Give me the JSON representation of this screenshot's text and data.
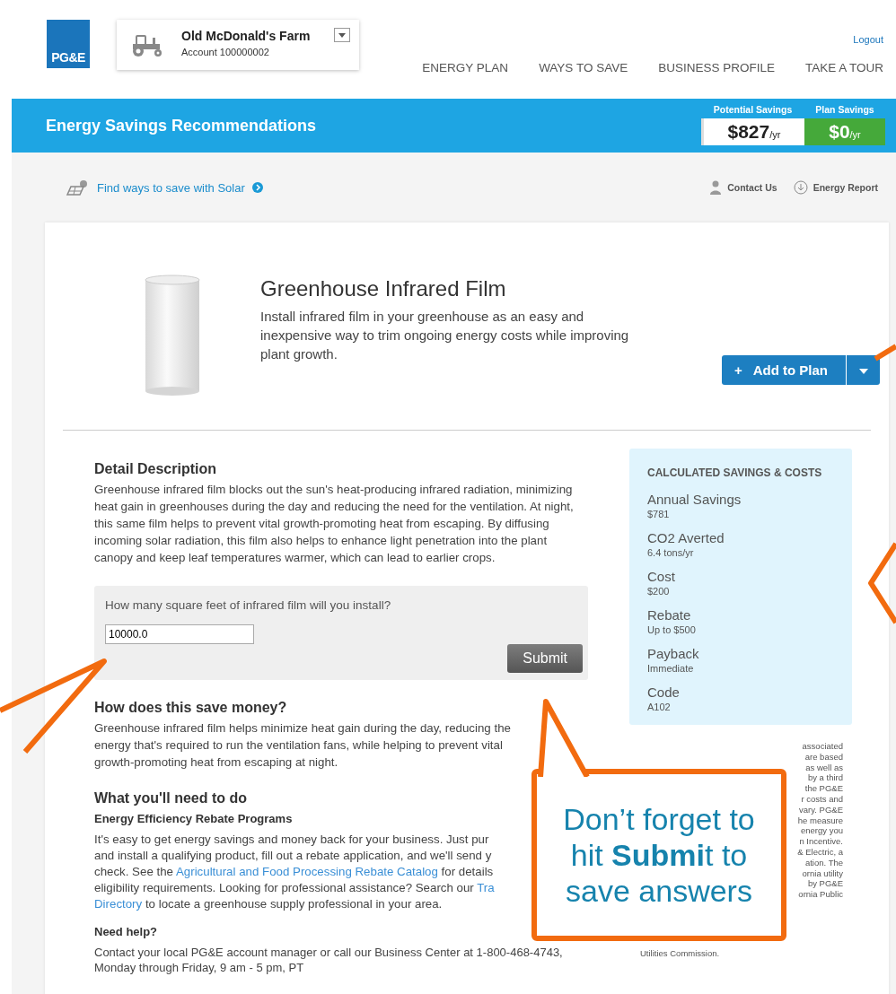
{
  "header": {
    "logo": "PG&E",
    "account": {
      "name": "Old McDonald's Farm",
      "number": "Account 100000002"
    },
    "logout": "Logout",
    "nav": [
      {
        "label": "ENERGY PLAN"
      },
      {
        "label": "WAYS TO SAVE"
      },
      {
        "label": "BUSINESS PROFILE"
      },
      {
        "label": "TAKE A TOUR"
      }
    ]
  },
  "banner": {
    "title": "Energy Savings Recommendations",
    "savings": [
      {
        "kind": "potential",
        "label": "Potential Savings",
        "amount": "$827",
        "unit": "/yr"
      },
      {
        "kind": "plan",
        "label": "Plan Savings",
        "amount": "$0",
        "unit": "/yr"
      }
    ]
  },
  "toolbar": {
    "solar_link": "Find ways to save with Solar",
    "links": [
      {
        "kind": "contact",
        "label": "Contact Us"
      },
      {
        "kind": "report",
        "label": "Energy Report"
      }
    ]
  },
  "product": {
    "title": "Greenhouse Infrared Film",
    "description": "Install infrared film in your greenhouse as an easy and inexpensive way to trim ongoing energy costs while improving plant growth.",
    "add_icon": "+",
    "add_button": "Add to Plan"
  },
  "detail": {
    "heading": "Detail Description",
    "text": "Greenhouse infrared film blocks out the sun's heat-producing infrared radiation, minimizing heat gain in greenhouses during the day and reducing the need for the ventilation. At night, this same film helps to prevent vital growth-promoting heat from escaping. By diffusing incoming solar radiation, this film also helps to enhance light penetration into the plant canopy and keep leaf temperatures warmer, which can lead to earlier crops."
  },
  "question": {
    "label": "How many square feet of infrared film will you install?",
    "value": "10000.0",
    "submit": "Submit"
  },
  "how": {
    "heading": "How does this save money?",
    "text": "Greenhouse infrared film helps minimize heat gain during the day, reducing the energy that's required to run the ventilation fans, while helping to prevent vital growth-promoting heat from escaping at night."
  },
  "todo": {
    "heading": "What you'll need to do",
    "subheading": "Energy Efficiency Rebate Programs",
    "lines": [
      [
        {
          "text": "It's easy to get energy savings and money back for your business. Just pur",
          "link": false
        }
      ],
      [
        {
          "text": "and install a qualifying product, fill out a rebate application, and we'll send y",
          "link": false
        }
      ],
      [
        {
          "text": "check. See the ",
          "link": false
        },
        {
          "text": "Agricultural and Food Processing Rebate Catalog",
          "link": true
        },
        {
          "text": " for details",
          "link": false
        }
      ],
      [
        {
          "text": "eligibility requirements. Looking for professional assistance? Search our ",
          "link": false
        },
        {
          "text": "Tra",
          "link": true
        }
      ],
      [
        {
          "text": "Directory",
          "link": true
        },
        {
          "text": " to locate a greenhouse supply professional in your area.",
          "link": false
        }
      ]
    ]
  },
  "help": {
    "heading": "Need help?",
    "text": "Contact your local PG&E account manager or call our Business Center at 1-800-468-4743, Monday through Friday, 9 am - 5 pm, PT"
  },
  "panel": {
    "title": "CALCULATED SAVINGS & COSTS",
    "items": [
      {
        "label": "Annual Savings",
        "value": "$781"
      },
      {
        "label": "CO2 Averted",
        "value": "6.4 tons/yr"
      },
      {
        "label": "Cost",
        "value": "$200"
      },
      {
        "label": "Rebate",
        "value": "Up to $500"
      },
      {
        "label": "Payback",
        "value": "Immediate"
      },
      {
        "label": "Code",
        "value": "A102"
      }
    ]
  },
  "disclaimer": {
    "fragments": [
      "associated",
      "are based",
      "as well as",
      "by a third",
      "the PG&E",
      "r costs and",
      "vary. PG&E",
      "he measure",
      "energy you",
      "n Incentive.",
      "& Electric, a",
      "ation. The",
      "ornia utility",
      "by PG&E",
      "ornia Public"
    ],
    "last_line": "Utilities Commission."
  },
  "callout": {
    "text": "Don’t forget to hit **Submi**t to save answers"
  }
}
